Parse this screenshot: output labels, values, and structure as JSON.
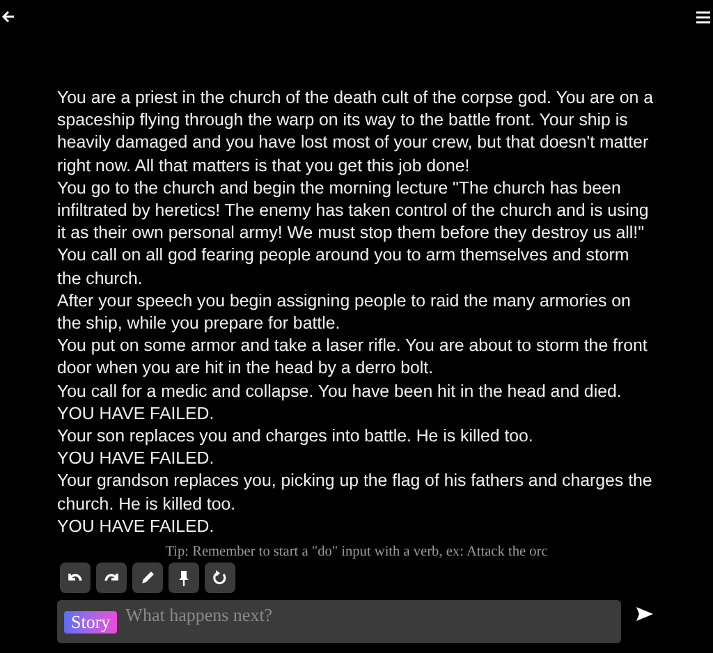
{
  "story": [
    "You are a priest in the church of the death cult of the corpse god. You are on a spaceship flying through the warp on its way to the battle front. Your ship is heavily damaged and you have lost most of your crew, but that doesn't matter right now. All that matters is that you get this job done!",
    "You go to the church and begin the morning lecture \"The church has been infiltrated by heretics! The enemy has taken control of the church and is using it as their own personal army! We must stop them before they destroy us all!\"",
    "You call on all god fearing people around you to arm themselves and storm the church.",
    "After your speech you begin assigning people to raid the many armories on the ship, while you prepare for battle.",
    "You put on some armor and take a laser rifle. You are about to storm the front door when you are hit in the head by a derro bolt.",
    "You call for a medic and collapse. You have been hit in the head and died.",
    "YOU HAVE FAILED.",
    "Your son replaces you and charges into battle. He is killed too.",
    "YOU HAVE FAILED.",
    "Your grandson replaces you, picking up the flag of his fathers and charges the church. He is killed too.",
    "YOU HAVE FAILED."
  ],
  "tip": "Tip: Remember to start a \"do\" input with a verb, ex: Attack the orc",
  "toolbar": [
    {
      "kind": "undo"
    },
    {
      "kind": "redo"
    },
    {
      "kind": "edit"
    },
    {
      "kind": "pin"
    },
    {
      "kind": "retry"
    }
  ],
  "input": {
    "mode": "Story",
    "placeholder": "What happens next?"
  }
}
